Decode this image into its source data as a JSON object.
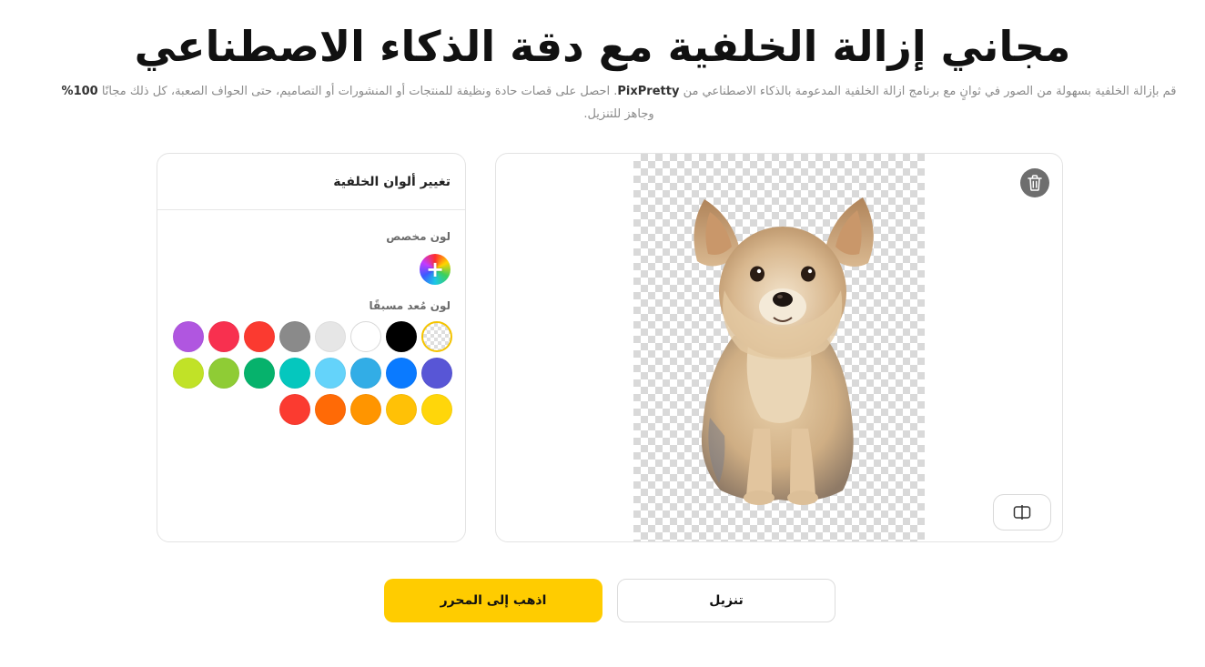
{
  "header": {
    "title_highlight": "مجاني",
    "title_rest": "إزالة الخلفية مع دقة الذكاء الاصطناعي",
    "subtitle_part1": "قم بإزالة الخلفية بسهولة من الصور في ثوانٍ مع برنامج ازالة الخلفية المدعومة بالذكاء الاصطناعي من ",
    "subtitle_brand": "PixPretty",
    "subtitle_part2": ". احصل على قصات حادة ونظيفة للمنتجات أو المنشورات أو التصاميم، حتى الحواف الصعبة، كل ذلك مجانًا ",
    "subtitle_percent": "100%",
    "subtitle_part3": " وجاهز للتنزيل."
  },
  "color_panel": {
    "title": "تغيير ألوان الخلفية",
    "custom_label": "لون مخصص",
    "preset_label": "لون مُعد مسبقًا",
    "presets": [
      {
        "name": "transparent",
        "color": "transparent"
      },
      {
        "name": "black",
        "color": "#000000"
      },
      {
        "name": "white",
        "color": "#ffffff"
      },
      {
        "name": "light-gray",
        "color": "#e6e6e6"
      },
      {
        "name": "gray",
        "color": "#8a8a8a"
      },
      {
        "name": "red",
        "color": "#fb3a30"
      },
      {
        "name": "crimson",
        "color": "#f8304f"
      },
      {
        "name": "purple",
        "color": "#b056e0"
      },
      {
        "name": "indigo",
        "color": "#5856d6"
      },
      {
        "name": "blue",
        "color": "#0a7aff"
      },
      {
        "name": "sky-blue",
        "color": "#32ade6"
      },
      {
        "name": "light-blue",
        "color": "#64d3fa"
      },
      {
        "name": "teal",
        "color": "#05c7be"
      },
      {
        "name": "green",
        "color": "#06b26c"
      },
      {
        "name": "lime-green",
        "color": "#8fcc35"
      },
      {
        "name": "yellow-green",
        "color": "#c1e227"
      },
      {
        "name": "yellow",
        "color": "#ffd60a"
      },
      {
        "name": "amber",
        "color": "#ffc106"
      },
      {
        "name": "orange",
        "color": "#ff9500"
      },
      {
        "name": "dark-orange",
        "color": "#ff6a06"
      },
      {
        "name": "red-orange",
        "color": "#fb3b30"
      }
    ]
  },
  "preview": {
    "delete_icon": "trash-icon",
    "compare_icon": "compare-icon"
  },
  "actions": {
    "editor_label": "اذهب إلى المحرر",
    "download_label": "تنزيل"
  },
  "colors": {
    "accent": "#ffcc00",
    "highlight": "#f7e51f"
  }
}
